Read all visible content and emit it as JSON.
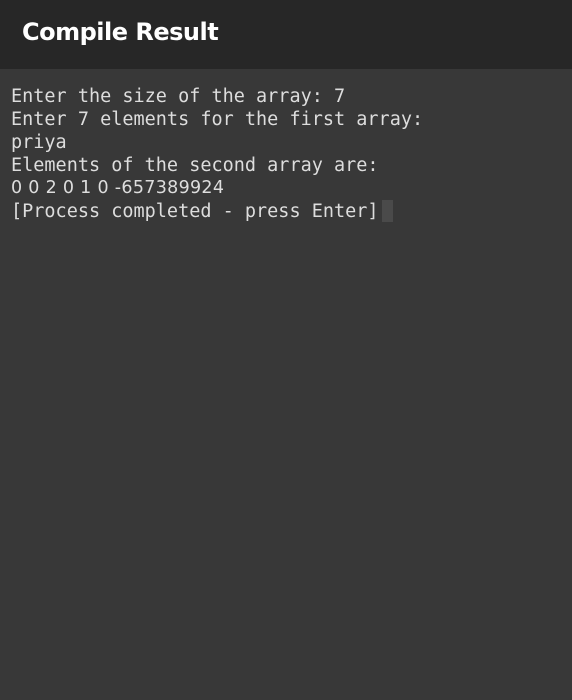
{
  "app_bar": {
    "title": "Compile Result"
  },
  "terminal": {
    "lines": [
      "Enter the size of the array: 7",
      "Enter 7 elements for the first array:",
      "priya",
      "Elements of the second array are:",
      "0 0 2 0 1 0 -657389924",
      "[Process completed - press Enter]"
    ]
  },
  "colors": {
    "app_bar_background": "#272727",
    "terminal_background": "#383838",
    "terminal_text": "#dddddd",
    "title_text": "#ffffff",
    "cursor": "#4a4a4a"
  }
}
